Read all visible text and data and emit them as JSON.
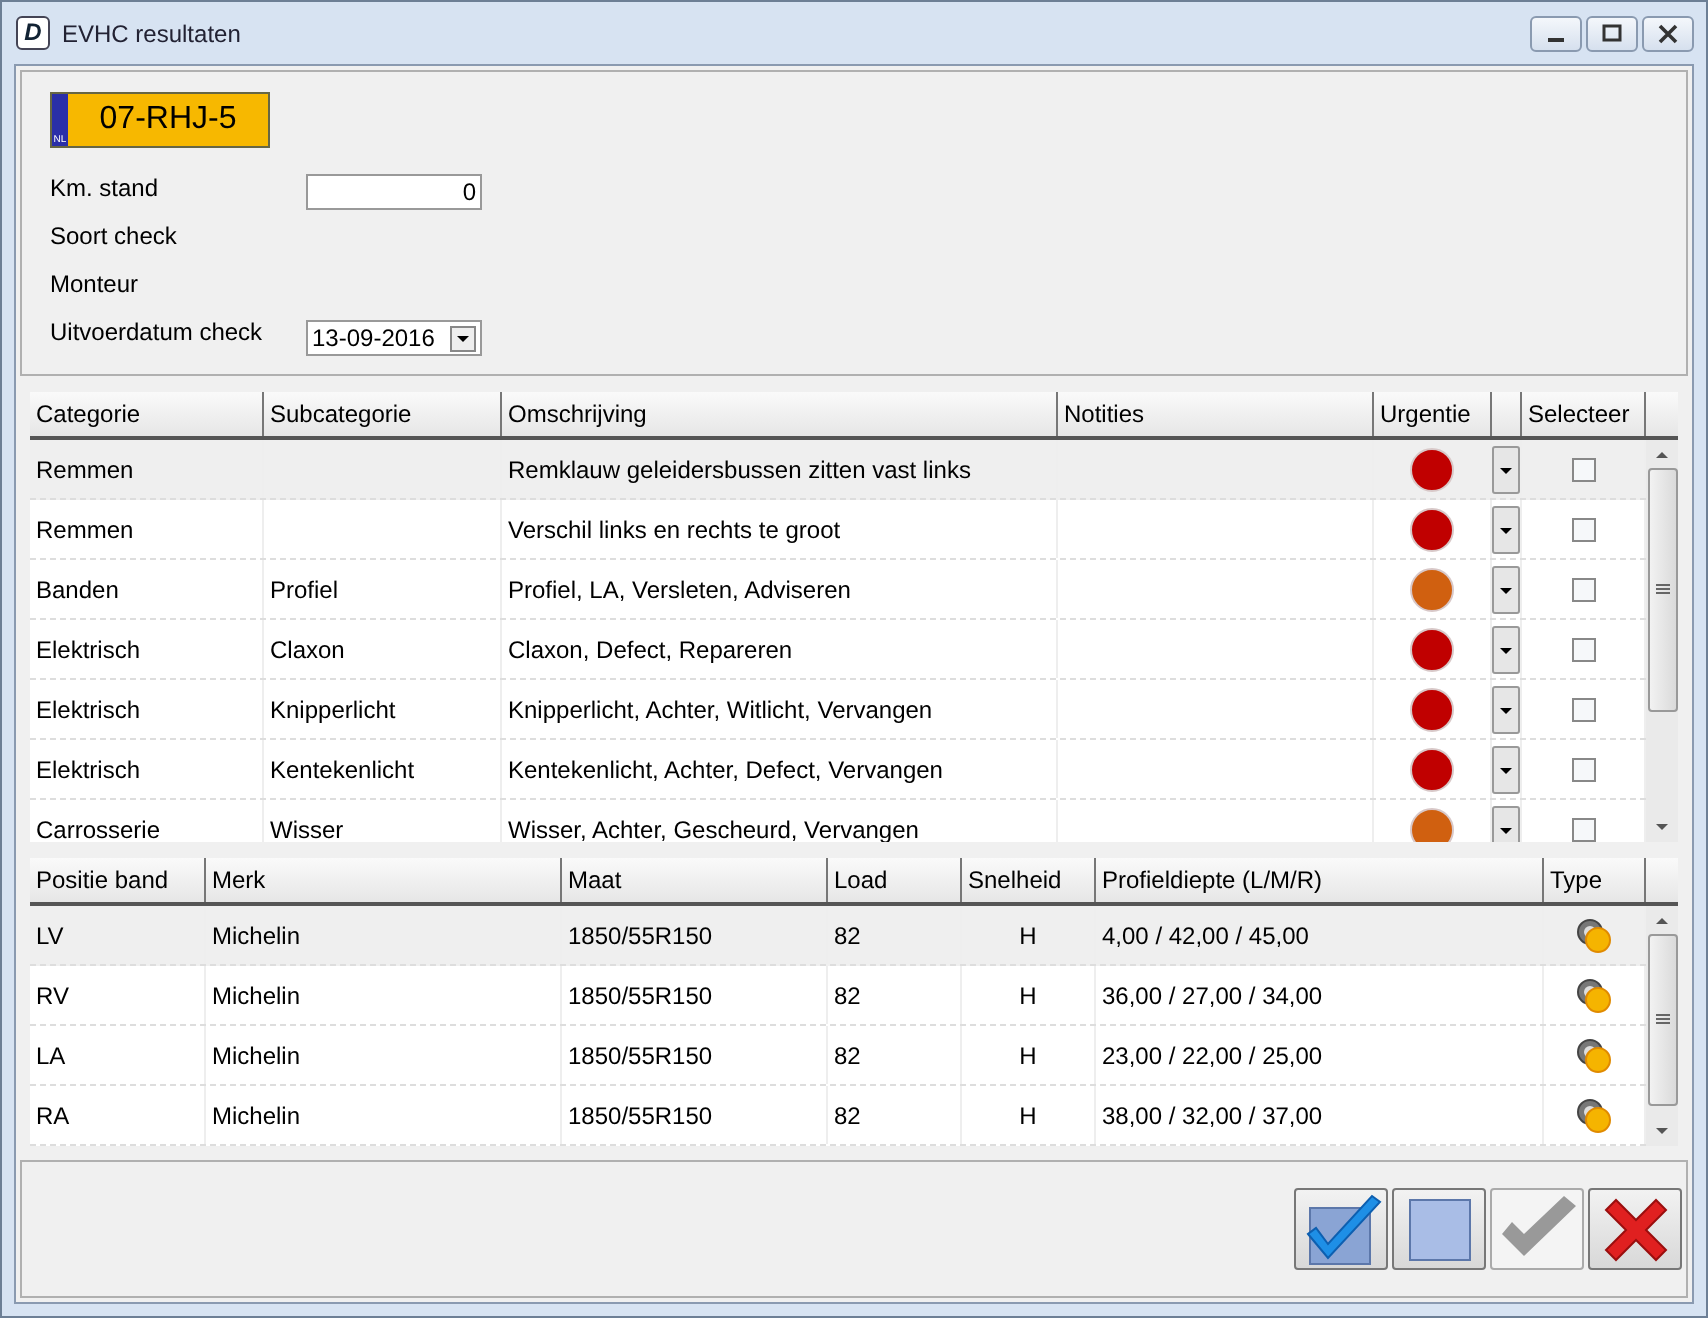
{
  "window": {
    "title": "EVHC resultaten",
    "app_icon": "D"
  },
  "header": {
    "plate": "07-RHJ-5",
    "plate_country": "NL",
    "fields": [
      {
        "label": "Km. stand",
        "kind": "text",
        "value": "0"
      },
      {
        "label": "Soort check",
        "kind": "none"
      },
      {
        "label": "Monteur",
        "kind": "none"
      },
      {
        "label": "Uitvoerdatum check",
        "kind": "date",
        "value": "13-09-2016"
      }
    ]
  },
  "checks": {
    "columns": [
      "Categorie",
      "Subcategorie",
      "Omschrijving",
      "Notities",
      "Urgentie",
      "Selecteer"
    ],
    "rows": [
      {
        "categorie": "Remmen",
        "subcategorie": "",
        "omschrijving": "Remklauw geleidersbussen zitten vast links",
        "color": "#c00000",
        "checked": false,
        "selected": true
      },
      {
        "categorie": "Remmen",
        "subcategorie": "",
        "omschrijving": "Verschil links en rechts te groot",
        "color": "#c00000",
        "checked": false,
        "selected": false
      },
      {
        "categorie": "Banden",
        "subcategorie": "Profiel",
        "omschrijving": "Profiel, LA, Versleten, Adviseren",
        "color": "#d06010",
        "checked": false,
        "selected": false
      },
      {
        "categorie": "Elektrisch",
        "subcategorie": "Claxon",
        "omschrijving": "Claxon, Defect, Repareren",
        "color": "#c00000",
        "checked": false,
        "selected": false
      },
      {
        "categorie": "Elektrisch",
        "subcategorie": "Knipperlicht",
        "omschrijving": "Knipperlicht, Achter, Witlicht, Vervangen",
        "color": "#c00000",
        "checked": false,
        "selected": false
      },
      {
        "categorie": "Elektrisch",
        "subcategorie": "Kentekenlicht",
        "omschrijving": "Kentekenlicht, Achter, Defect, Vervangen",
        "color": "#c00000",
        "checked": false,
        "selected": false
      },
      {
        "categorie": "Carrosserie",
        "subcategorie": "Wisser",
        "omschrijving": "Wisser, Achter, Gescheurd, Vervangen",
        "color": "#d06010",
        "checked": false,
        "selected": false
      }
    ]
  },
  "tyres": {
    "columns": [
      "Positie band",
      "Merk",
      "Maat",
      "Load",
      "Snelheid",
      "Profieldiepte (L/M/R)",
      "Type"
    ],
    "rows": [
      {
        "positie": "LV",
        "merk": "Michelin",
        "maat": "1850/55R150",
        "load": "82",
        "snelheid": "H",
        "profiel": "4,00 / 42,00 / 45,00",
        "selected": true
      },
      {
        "positie": "RV",
        "merk": "Michelin",
        "maat": "1850/55R150",
        "load": "82",
        "snelheid": "H",
        "profiel": "36,00 / 27,00 / 34,00",
        "selected": false
      },
      {
        "positie": "LA",
        "merk": "Michelin",
        "maat": "1850/55R150",
        "load": "82",
        "snelheid": "H",
        "profiel": "23,00 / 22,00 / 25,00",
        "selected": false
      },
      {
        "positie": "RA",
        "merk": "Michelin",
        "maat": "1850/55R150",
        "load": "82",
        "snelheid": "H",
        "profiel": "38,00 / 32,00 / 37,00",
        "selected": false
      }
    ]
  },
  "buttons": [
    {
      "kind": "confirm-all",
      "disabled": false
    },
    {
      "kind": "clear",
      "disabled": false
    },
    {
      "kind": "confirm",
      "disabled": true
    },
    {
      "kind": "cancel",
      "disabled": false
    }
  ]
}
